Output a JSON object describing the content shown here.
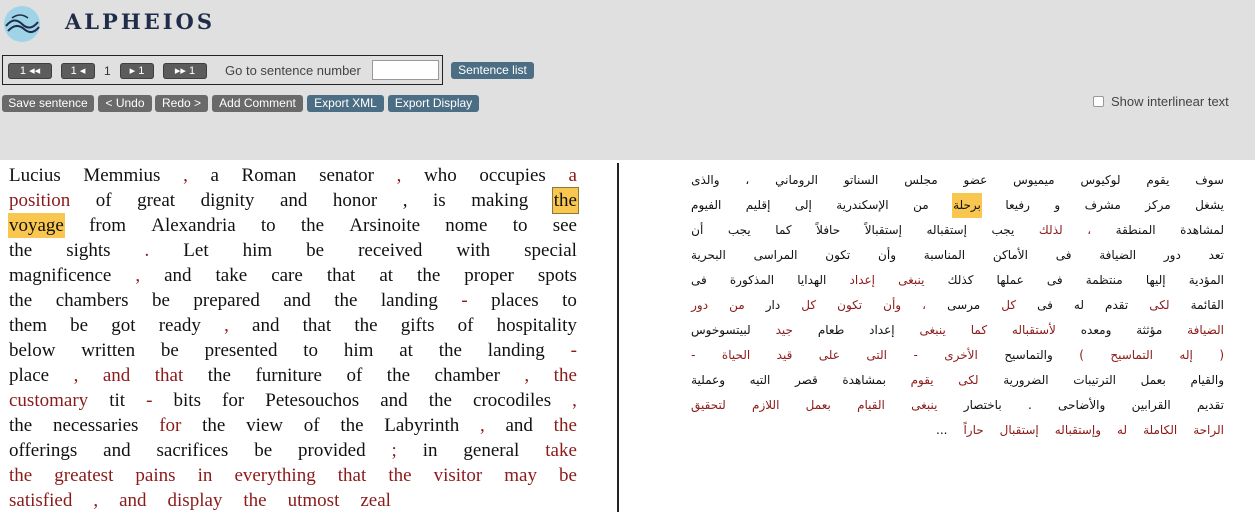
{
  "app": {
    "logo_text": "ALPHEIOS"
  },
  "toolbar": {
    "first": "1 ◂◂",
    "prev": "1 ◂",
    "current": "1",
    "next": "▸ 1",
    "last": "▸▸ 1",
    "goto_label": "Go to sentence number",
    "goto_value": "",
    "sentence_list": "Sentence list"
  },
  "actions": {
    "save": "Save sentence",
    "undo": "< Undo",
    "redo": "Redo >",
    "comment": "Add Comment",
    "export_xml": "Export XML",
    "export_display": "Export Display",
    "interlinear_label": "Show interlinear text",
    "interlinear_checked": false
  },
  "colors": {
    "highlight": "#f9c74f",
    "aligned": "#8b1a1a",
    "button_gray": "#6a6a6a",
    "button_blue": "#4c6e84"
  },
  "left_lines": [
    [
      {
        "t": "Lucius"
      },
      {
        "t": "Memmius"
      },
      {
        "t": ",",
        "c": "r"
      },
      {
        "t": "a"
      },
      {
        "t": "Roman"
      },
      {
        "t": "senator"
      },
      {
        "t": ",",
        "c": "r"
      },
      {
        "t": "who"
      },
      {
        "t": "occupies"
      },
      {
        "t": "a",
        "c": "r"
      }
    ],
    [
      {
        "t": "position",
        "c": "r"
      },
      {
        "t": "of"
      },
      {
        "t": "great"
      },
      {
        "t": "dignity"
      },
      {
        "t": "and"
      },
      {
        "t": "honor"
      },
      {
        "t": ","
      },
      {
        "t": "is"
      },
      {
        "t": "making"
      },
      {
        "t": "the",
        "c": "hb"
      }
    ],
    [
      {
        "t": "voyage",
        "c": "h"
      },
      {
        "t": "from"
      },
      {
        "t": "Alexandria"
      },
      {
        "t": "to"
      },
      {
        "t": "the"
      },
      {
        "t": "Arsinoite"
      },
      {
        "t": "nome"
      },
      {
        "t": "to"
      },
      {
        "t": "see"
      }
    ],
    [
      {
        "t": "the"
      },
      {
        "t": "sights"
      },
      {
        "t": ".",
        "c": "r"
      },
      {
        "t": "Let"
      },
      {
        "t": "him"
      },
      {
        "t": "be"
      },
      {
        "t": "received"
      },
      {
        "t": "with"
      },
      {
        "t": "special"
      }
    ],
    [
      {
        "t": "magnificence"
      },
      {
        "t": ",",
        "c": "r"
      },
      {
        "t": "and"
      },
      {
        "t": "take"
      },
      {
        "t": "care"
      },
      {
        "t": "that"
      },
      {
        "t": "at"
      },
      {
        "t": "the"
      },
      {
        "t": "proper"
      },
      {
        "t": "spots"
      }
    ],
    [
      {
        "t": "the"
      },
      {
        "t": "chambers"
      },
      {
        "t": "be"
      },
      {
        "t": "prepared"
      },
      {
        "t": "and"
      },
      {
        "t": "the"
      },
      {
        "t": "landing"
      },
      {
        "t": "-",
        "c": "r"
      },
      {
        "t": "places"
      },
      {
        "t": "to"
      }
    ],
    [
      {
        "t": "them"
      },
      {
        "t": "be"
      },
      {
        "t": "got"
      },
      {
        "t": "ready"
      },
      {
        "t": ",",
        "c": "r"
      },
      {
        "t": "and"
      },
      {
        "t": "that"
      },
      {
        "t": "the"
      },
      {
        "t": "gifts"
      },
      {
        "t": "of"
      },
      {
        "t": "hospitality"
      }
    ],
    [
      {
        "t": "below"
      },
      {
        "t": "written"
      },
      {
        "t": "be"
      },
      {
        "t": "presented"
      },
      {
        "t": "to"
      },
      {
        "t": "him"
      },
      {
        "t": "at"
      },
      {
        "t": "the"
      },
      {
        "t": "landing"
      },
      {
        "t": "-",
        "c": "r"
      }
    ],
    [
      {
        "t": "place"
      },
      {
        "t": ",",
        "c": "r"
      },
      {
        "t": "and",
        "c": "r"
      },
      {
        "t": "that",
        "c": "r"
      },
      {
        "t": "the"
      },
      {
        "t": "furniture"
      },
      {
        "t": "of"
      },
      {
        "t": "the"
      },
      {
        "t": "chamber"
      },
      {
        "t": ",",
        "c": "r"
      },
      {
        "t": "the",
        "c": "r"
      }
    ],
    [
      {
        "t": "customary",
        "c": "r"
      },
      {
        "t": "tit"
      },
      {
        "t": "-",
        "c": "r"
      },
      {
        "t": "bits"
      },
      {
        "t": "for"
      },
      {
        "t": "Petesouchos"
      },
      {
        "t": "and"
      },
      {
        "t": "the"
      },
      {
        "t": "crocodiles"
      },
      {
        "t": ",",
        "c": "r"
      }
    ],
    [
      {
        "t": "the"
      },
      {
        "t": "necessaries"
      },
      {
        "t": "for",
        "c": "r"
      },
      {
        "t": "the"
      },
      {
        "t": "view"
      },
      {
        "t": "of"
      },
      {
        "t": "the"
      },
      {
        "t": "Labyrinth"
      },
      {
        "t": ",",
        "c": "r"
      },
      {
        "t": "and"
      },
      {
        "t": "the",
        "c": "r"
      }
    ],
    [
      {
        "t": "offerings"
      },
      {
        "t": "and"
      },
      {
        "t": "sacrifices"
      },
      {
        "t": "be"
      },
      {
        "t": "provided"
      },
      {
        "t": ";",
        "c": "r"
      },
      {
        "t": "in"
      },
      {
        "t": "general"
      },
      {
        "t": "take",
        "c": "r"
      }
    ],
    [
      {
        "t": "the",
        "c": "r"
      },
      {
        "t": "greatest",
        "c": "r"
      },
      {
        "t": "pains",
        "c": "r"
      },
      {
        "t": "in",
        "c": "r"
      },
      {
        "t": "everything",
        "c": "r"
      },
      {
        "t": "that",
        "c": "r"
      },
      {
        "t": "the",
        "c": "r"
      },
      {
        "t": "visitor",
        "c": "r"
      },
      {
        "t": "may",
        "c": "r"
      },
      {
        "t": "be",
        "c": "r"
      }
    ],
    [
      {
        "t": "satisfied",
        "c": "r"
      },
      {
        "t": ",",
        "c": "r"
      },
      {
        "t": "and",
        "c": "r"
      },
      {
        "t": "display",
        "c": "r"
      },
      {
        "t": "the",
        "c": "r"
      },
      {
        "t": "utmost",
        "c": "r"
      },
      {
        "t": "zeal",
        "c": "r"
      }
    ]
  ],
  "right_lines": [
    [
      {
        "t": "سوف"
      },
      {
        "t": "يقوم"
      },
      {
        "t": "لوكيوس"
      },
      {
        "t": "ميميوس"
      },
      {
        "t": "عضو"
      },
      {
        "t": "مجلس"
      },
      {
        "t": "السناتو"
      },
      {
        "t": "الروماني"
      },
      {
        "t": "،"
      },
      {
        "t": "والذى"
      }
    ],
    [
      {
        "t": "يشغل"
      },
      {
        "t": "مركز"
      },
      {
        "t": "مشرف"
      },
      {
        "t": "و"
      },
      {
        "t": "رفيعا"
      },
      {
        "t": "برحلة",
        "c": "h"
      },
      {
        "t": "من"
      },
      {
        "t": "الإسكندرية"
      },
      {
        "t": "إلى"
      },
      {
        "t": "إقليم"
      },
      {
        "t": "الفيوم"
      }
    ],
    [
      {
        "t": "لمشاهدة"
      },
      {
        "t": "المنطقة"
      },
      {
        "t": "،",
        "c": "r"
      },
      {
        "t": "لذلك",
        "c": "r"
      },
      {
        "t": "يجب"
      },
      {
        "t": "إستقباله"
      },
      {
        "t": "إستقبالاً"
      },
      {
        "t": "حافلاً"
      },
      {
        "t": "كما"
      },
      {
        "t": "يجب"
      },
      {
        "t": "أن"
      }
    ],
    [
      {
        "t": "تعد"
      },
      {
        "t": "دور"
      },
      {
        "t": "الضيافة"
      },
      {
        "t": "فى"
      },
      {
        "t": "الأماكن"
      },
      {
        "t": "المناسبة"
      },
      {
        "t": "وأن"
      },
      {
        "t": "تكون"
      },
      {
        "t": "المراسى"
      },
      {
        "t": "البحرية"
      }
    ],
    [
      {
        "t": "المؤدية"
      },
      {
        "t": "إليها"
      },
      {
        "t": "منتظمة"
      },
      {
        "t": "فى"
      },
      {
        "t": "عملها"
      },
      {
        "t": "كذلك"
      },
      {
        "t": "ينبغى",
        "c": "r"
      },
      {
        "t": "إعداد",
        "c": "r"
      },
      {
        "t": "الهدايا"
      },
      {
        "t": "المذكورة"
      },
      {
        "t": "فى"
      }
    ],
    [
      {
        "t": "القائمة"
      },
      {
        "t": "لكى",
        "c": "r"
      },
      {
        "t": "تقدم"
      },
      {
        "t": "له"
      },
      {
        "t": "فى"
      },
      {
        "t": "كل",
        "c": "r"
      },
      {
        "t": "مرسى"
      },
      {
        "t": "،",
        "c": "r"
      },
      {
        "t": "وأن",
        "c": "r"
      },
      {
        "t": "تكون",
        "c": "r"
      },
      {
        "t": "كل",
        "c": "r"
      },
      {
        "t": "دار"
      },
      {
        "t": "من",
        "c": "r"
      },
      {
        "t": "دور",
        "c": "r"
      }
    ],
    [
      {
        "t": "الضيافة",
        "c": "r"
      },
      {
        "t": "مؤثثة"
      },
      {
        "t": "ومعده"
      },
      {
        "t": "لأستقباله",
        "c": "r"
      },
      {
        "t": "كما",
        "c": "r"
      },
      {
        "t": "ينبغى",
        "c": "r"
      },
      {
        "t": "إعداد"
      },
      {
        "t": "طعام"
      },
      {
        "t": "جيد",
        "c": "r"
      },
      {
        "t": "لبيتسوخوس"
      }
    ],
    [
      {
        "t": "(",
        "c": "r"
      },
      {
        "t": "إله",
        "c": "r"
      },
      {
        "t": "التماسيح",
        "c": "r"
      },
      {
        "t": ")",
        "c": "r"
      },
      {
        "t": "والتماسيح"
      },
      {
        "t": "الأخرى",
        "c": "r"
      },
      {
        "t": "-",
        "c": "r"
      },
      {
        "t": "التى",
        "c": "r"
      },
      {
        "t": "على",
        "c": "r"
      },
      {
        "t": "قيد",
        "c": "r"
      },
      {
        "t": "الحياة",
        "c": "r"
      },
      {
        "t": "-",
        "c": "r"
      }
    ],
    [
      {
        "t": "والقيام"
      },
      {
        "t": "بعمل"
      },
      {
        "t": "الترتيبات"
      },
      {
        "t": "الضرورية"
      },
      {
        "t": "لكى",
        "c": "r"
      },
      {
        "t": "يقوم",
        "c": "r"
      },
      {
        "t": "بمشاهدة"
      },
      {
        "t": "قصر"
      },
      {
        "t": "التيه"
      },
      {
        "t": "وعملية"
      }
    ],
    [
      {
        "t": "تقديم"
      },
      {
        "t": "القرابين"
      },
      {
        "t": "والأضاحى"
      },
      {
        "t": "."
      },
      {
        "t": "باختصار"
      },
      {
        "t": "ينبغى",
        "c": "r"
      },
      {
        "t": "القيام",
        "c": "r"
      },
      {
        "t": "بعمل",
        "c": "r"
      },
      {
        "t": "اللازم",
        "c": "r"
      },
      {
        "t": "لتحقيق",
        "c": "r"
      }
    ],
    [
      {
        "t": "الراحة",
        "c": "r"
      },
      {
        "t": "الكاملة",
        "c": "r"
      },
      {
        "t": "له",
        "c": "r"
      },
      {
        "t": "وإستقباله",
        "c": "r"
      },
      {
        "t": "إستقبال",
        "c": "r"
      },
      {
        "t": "حاراً",
        "c": "r"
      },
      {
        "t": "..."
      }
    ]
  ]
}
